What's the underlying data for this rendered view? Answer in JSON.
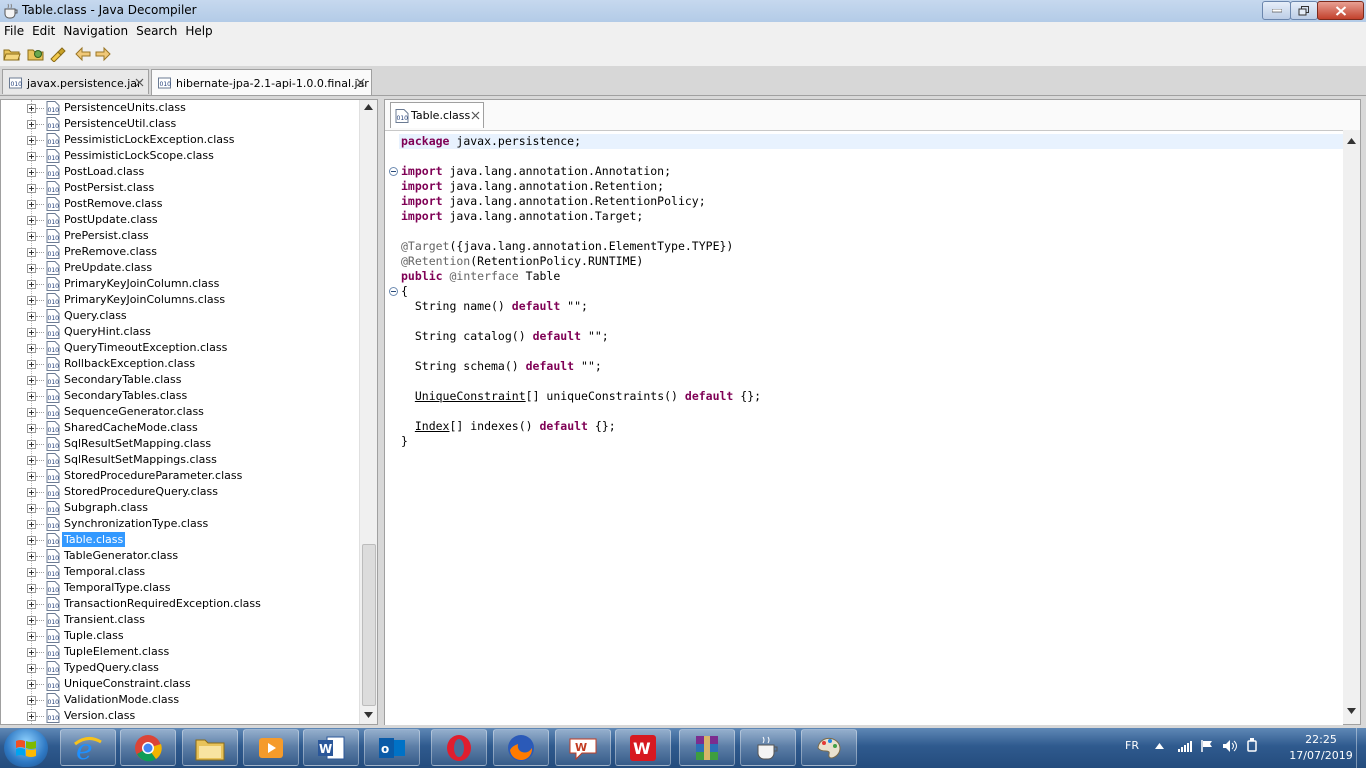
{
  "window": {
    "title": "Table.class - Java Decompiler"
  },
  "menu": [
    "File",
    "Edit",
    "Navigation",
    "Search",
    "Help"
  ],
  "jar_tabs": [
    {
      "label": "javax.persistence.jar",
      "active": false
    },
    {
      "label": "hibernate-jpa-2.1-api-1.0.0.final.jar",
      "active": true
    }
  ],
  "tree": {
    "items": [
      "PersistenceUnits.class",
      "PersistenceUtil.class",
      "PessimisticLockException.class",
      "PessimisticLockScope.class",
      "PostLoad.class",
      "PostPersist.class",
      "PostRemove.class",
      "PostUpdate.class",
      "PrePersist.class",
      "PreRemove.class",
      "PreUpdate.class",
      "PrimaryKeyJoinColumn.class",
      "PrimaryKeyJoinColumns.class",
      "Query.class",
      "QueryHint.class",
      "QueryTimeoutException.class",
      "RollbackException.class",
      "SecondaryTable.class",
      "SecondaryTables.class",
      "SequenceGenerator.class",
      "SharedCacheMode.class",
      "SqlResultSetMapping.class",
      "SqlResultSetMappings.class",
      "StoredProcedureParameter.class",
      "StoredProcedureQuery.class",
      "Subgraph.class",
      "SynchronizationType.class",
      "Table.class",
      "TableGenerator.class",
      "Temporal.class",
      "TemporalType.class",
      "TransactionRequiredException.class",
      "Transient.class",
      "Tuple.class",
      "TupleElement.class",
      "TypedQuery.class",
      "UniqueConstraint.class",
      "ValidationMode.class",
      "Version.class"
    ],
    "selected": "Table.class"
  },
  "editor": {
    "tab_label": "Table.class",
    "code": {
      "l1": [
        "package",
        " javax.persistence;"
      ],
      "l2": [
        "import",
        " java.lang.annotation.Annotation;"
      ],
      "l3": [
        "import",
        " java.lang.annotation.Retention;"
      ],
      "l4": [
        "import",
        " java.lang.annotation.RetentionPolicy;"
      ],
      "l5": [
        "import",
        " java.lang.annotation.Target;"
      ],
      "l6": [
        "@Target",
        "({java.lang.annotation.ElementType.TYPE})"
      ],
      "l7": [
        "@Retention",
        "(RetentionPolicy.RUNTIME)"
      ],
      "l8": [
        "public",
        " ",
        "@interface",
        " Table"
      ],
      "l9": "{",
      "l10": [
        "  String name() ",
        "default",
        " \"\";"
      ],
      "l11": [
        "  String catalog() ",
        "default",
        " \"\";"
      ],
      "l12": [
        "  String schema() ",
        "default",
        " \"\";"
      ],
      "l13": [
        "  ",
        "UniqueConstraint",
        "[] uniqueConstraints() ",
        "default",
        " {};"
      ],
      "l14": [
        "  ",
        "Index",
        "[] indexes() ",
        "default",
        " {};"
      ],
      "l15": "}"
    }
  },
  "taskbar": {
    "apps": [
      "internet-explorer",
      "chrome",
      "file-explorer",
      "media-player",
      "word",
      "outlook",
      "opera",
      "firefox",
      "messenger",
      "winamax",
      "winrar",
      "java-decompiler",
      "paint"
    ],
    "language": "FR",
    "time": "22:25",
    "date": "17/07/2019"
  },
  "colors": {
    "keyword": "#7f0055",
    "annotation": "#646464",
    "selection": "#3399ff",
    "current_line": "#e8f2fe"
  }
}
